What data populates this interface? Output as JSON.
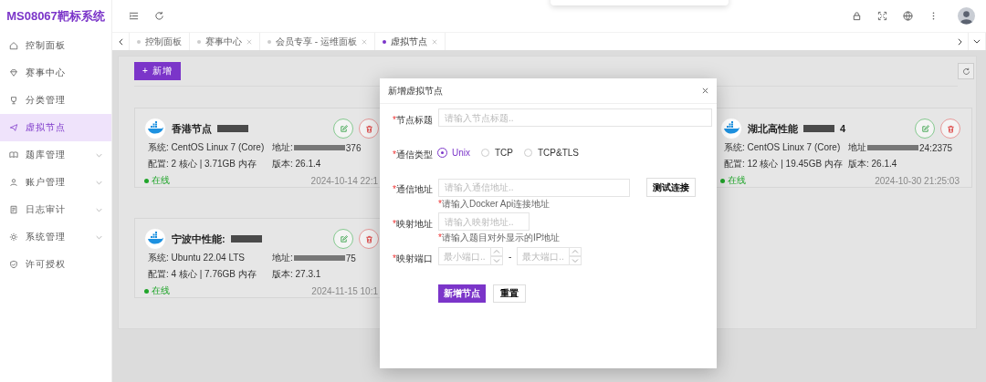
{
  "logo": "MS08067靶标系统",
  "sidebar": {
    "items": [
      {
        "label": "控制面板",
        "selected": false,
        "has_submenu": false
      },
      {
        "label": "赛事中心",
        "selected": false,
        "has_submenu": false
      },
      {
        "label": "分类管理",
        "selected": false,
        "has_submenu": false
      },
      {
        "label": "虚拟节点",
        "selected": true,
        "has_submenu": false
      },
      {
        "label": "题库管理",
        "selected": false,
        "has_submenu": true
      },
      {
        "label": "账户管理",
        "selected": false,
        "has_submenu": true
      },
      {
        "label": "日志审计",
        "selected": false,
        "has_submenu": true
      },
      {
        "label": "系统管理",
        "selected": false,
        "has_submenu": true
      },
      {
        "label": "许可授权",
        "selected": false,
        "has_submenu": false
      }
    ]
  },
  "tabs": [
    {
      "label": "控制面板",
      "selected": false,
      "closable": false
    },
    {
      "label": "赛事中心",
      "selected": false,
      "closable": true
    },
    {
      "label": "会员专享 - 运维面板",
      "selected": false,
      "closable": true
    },
    {
      "label": "虚拟节点",
      "selected": true,
      "closable": true
    }
  ],
  "toolbar": {
    "add_button": "+ 新增"
  },
  "cards": [
    {
      "title": "香港节点",
      "system": "系统: CentOS Linux 7 (Core)",
      "address_label": "地址:",
      "address_tail": "376",
      "config": "配置: 2 核心 | 3.71GB 内存",
      "version": "版本: 26.1.4",
      "online": true,
      "status": "在线",
      "date": "2024-10-14 22:1"
    },
    {
      "title": "湖北高性能",
      "title_tail": "4",
      "system": "系统: CentOS Linux 7 (Core)",
      "address_label": "地址",
      "address_tail": "24:2375",
      "config": "配置: 12 核心 | 19.45GB 内存",
      "version": "版本: 26.1.4",
      "online": true,
      "status": "在线",
      "date": "2024-10-30 21:25:03"
    },
    {
      "title": "宁波中性能:",
      "system": "系统: Ubuntu 22.04 LTS",
      "address_label": "地址:",
      "address_tail": "75",
      "config": "配置: 4 核心 | 7.76GB 内存",
      "version": "版本: 27.3.1",
      "online": true,
      "status": "在线",
      "date": "2024-11-15 10:1"
    }
  ],
  "dialog": {
    "title": "新增虚拟节点",
    "fields": [
      {
        "kind": "text",
        "mark": "*",
        "label": "节点标题",
        "placeholder": "请输入节点标题.."
      },
      {
        "kind": "radio",
        "mark": "*",
        "label": "通信类型",
        "options": [
          {
            "label": "Unix",
            "selected": true
          },
          {
            "label": "TCP",
            "selected": false
          },
          {
            "label": "TCP&TLS",
            "selected": false
          }
        ]
      },
      {
        "kind": "text_button",
        "mark": "*",
        "label": "通信地址",
        "placeholder": "请输入通信地址..",
        "button": "测试连接",
        "hint_mark": "*",
        "hint": "请输入Docker Api连接地址"
      },
      {
        "kind": "short_text",
        "mark": "*",
        "label": "映射地址",
        "placeholder": "请输入映射地址..",
        "hint_mark": "*",
        "hint": "请输入题目对外显示的IP地址"
      },
      {
        "kind": "range",
        "mark": "*",
        "label": "映射端口",
        "min_placeholder": "最小端口..",
        "separator": "-",
        "max_placeholder": "最大端口.."
      }
    ],
    "submit": "新增节点",
    "reset": "重置"
  }
}
